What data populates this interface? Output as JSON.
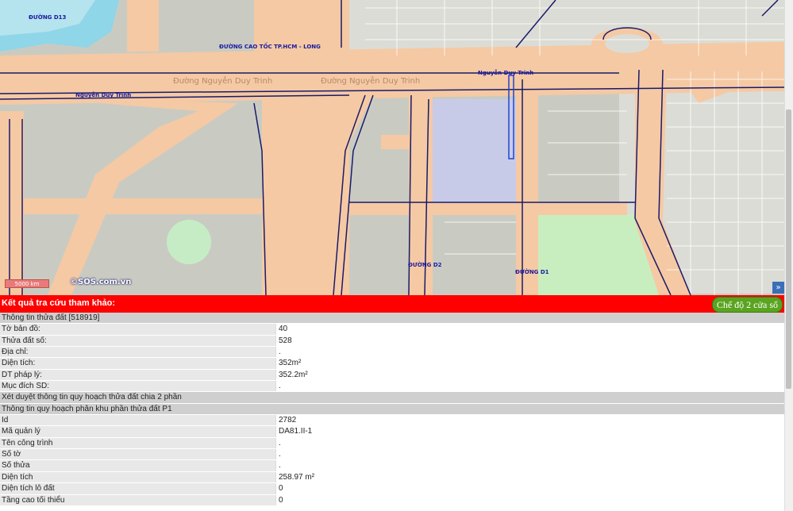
{
  "map": {
    "street_labels": {
      "duong_d13": "ĐƯỜNG D13",
      "cao_toc": "ĐƯỜNG CAO TỐC TP.HCM - LONG",
      "nguyen_duy_trinh_left": "Nguyễn Duy Trinh",
      "nguyen_duy_trinh_right": "Nguyễn Duy Trinh",
      "duong_d2": "ĐƯỜNG D2",
      "duong_d1": "ĐƯỜNG D1"
    },
    "road_labels": {
      "road1": "Đường Nguyễn Duy Trinh",
      "road2": "Đường Nguyễn Duy Trinh"
    },
    "scale": "5000 km",
    "copyright": "©SOS.com.vn",
    "expand_icon": "»"
  },
  "result": {
    "title": "Kết quả tra cứu tham khảo:",
    "split_button": "Chế độ 2 cửa sổ"
  },
  "rows": [
    {
      "type": "section",
      "label": "Thông tin thửa đất [518919]"
    },
    {
      "type": "field",
      "label": "Tờ bản đồ:",
      "value": "40"
    },
    {
      "type": "field",
      "label": "Thửa đất số:",
      "value": "528"
    },
    {
      "type": "field",
      "label": "Địa chỉ:",
      "value": "."
    },
    {
      "type": "field",
      "label": "Diện tích:",
      "value": "352m²"
    },
    {
      "type": "field",
      "label": "DT pháp lý:",
      "value": "352.2m²"
    },
    {
      "type": "field",
      "label": "Mục đích SD:",
      "value": "."
    },
    {
      "type": "section",
      "label": "Xét duyệt thông tin quy hoạch thửa đất chia 2 phần"
    },
    {
      "type": "section",
      "label": "Thông tin quy hoạch phân khu phần thửa đất P1"
    },
    {
      "type": "field",
      "label": "Id",
      "value": "2782"
    },
    {
      "type": "field",
      "label": "Mã quản lý",
      "value": "DA81.II-1"
    },
    {
      "type": "field",
      "label": "Tên công trình",
      "value": "."
    },
    {
      "type": "field",
      "label": "Số tờ",
      "value": "."
    },
    {
      "type": "field",
      "label": "Số thửa",
      "value": "."
    },
    {
      "type": "field",
      "label": "Diện tích",
      "value": "258.97 m²"
    },
    {
      "type": "field",
      "label": "Diện tích lô đất",
      "value": "0"
    },
    {
      "type": "field",
      "label": "Tầng cao tối thiểu",
      "value": "0"
    }
  ],
  "colors": {
    "header_red": "#ff0000",
    "button_green": "#5aa420",
    "map_road_orange": "#f5c9a3",
    "map_block_grey": "#c9cbc2",
    "map_blue_block": "#c8cbe8",
    "map_green_park": "#c8eec0",
    "map_water": "#7fd0e8"
  }
}
